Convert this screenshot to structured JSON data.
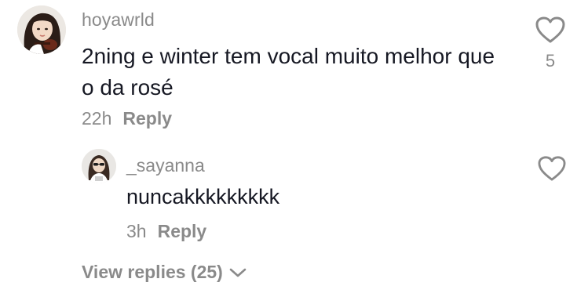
{
  "comment": {
    "username": "hoyawrld",
    "text": "2ning e winter tem vocal muito melhor que o da rosé",
    "time": "22h",
    "reply_label": "Reply",
    "like_count": "5",
    "like_icon": "heart-outline-icon"
  },
  "reply": {
    "username": "_sayanna",
    "text": "nuncakkkkkkkkk",
    "time": "3h",
    "reply_label": "Reply",
    "like_icon": "heart-outline-icon"
  },
  "view_replies": {
    "label": "View replies (25)",
    "icon": "chevron-down-icon"
  },
  "colors": {
    "primary_text": "#161823",
    "secondary_text": "#8a8a8a",
    "background": "#ffffff"
  }
}
